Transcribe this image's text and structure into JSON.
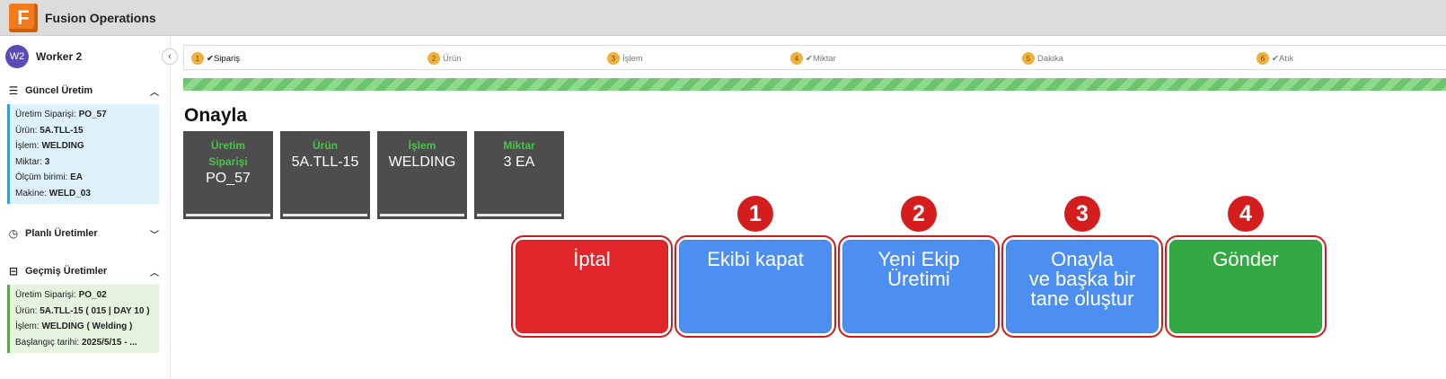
{
  "app": {
    "logo_letter": "F",
    "title": "Fusion Operations"
  },
  "user": {
    "initials": "W2",
    "name": "Worker 2"
  },
  "sidebar": {
    "current": {
      "title": "Güncel Üretim",
      "lines": [
        {
          "label": "Üretim Siparişi: ",
          "value": "PO_57"
        },
        {
          "label": "Ürün: ",
          "value": "5A.TLL-15"
        },
        {
          "label": "İşlem: ",
          "value": "WELDING"
        },
        {
          "label": "Miktar: ",
          "value": "3"
        },
        {
          "label": "Ölçüm birimi: ",
          "value": "EA"
        },
        {
          "label": "Makine: ",
          "value": "WELD_03"
        }
      ]
    },
    "planned": {
      "title": "Planlı Üretimler"
    },
    "past": {
      "title": "Geçmiş Üretimler",
      "lines": [
        {
          "label": "Üretim Siparişi: ",
          "value": "PO_02"
        },
        {
          "label": "Ürün: ",
          "value": "5A.TLL-15 ( 015 | DAY 10 )"
        },
        {
          "label": "İşlem: ",
          "value": "WELDING ( Welding )"
        },
        {
          "label": "Başlangıç tarihi: ",
          "value": "2025/5/15 - ..."
        }
      ]
    }
  },
  "steps": [
    {
      "num": "1",
      "check": "✔",
      "label": "Sipariş",
      "active": true
    },
    {
      "num": "2",
      "check": "",
      "label": "Ürün",
      "active": false
    },
    {
      "num": "3",
      "check": "",
      "label": "İşlem",
      "active": false
    },
    {
      "num": "4",
      "check": "✔",
      "label": "Miktar",
      "active": false
    },
    {
      "num": "5",
      "check": "",
      "label": "Dakika",
      "active": false
    },
    {
      "num": "6",
      "check": "✔",
      "label": "Atık",
      "active": false
    }
  ],
  "confirm": {
    "title": "Onayla",
    "cards": [
      {
        "label": "Üretim Siparişi",
        "value": "PO_57"
      },
      {
        "label": "Ürün",
        "value": "5A.TLL-15"
      },
      {
        "label": "İşlem",
        "value": "WELDING"
      },
      {
        "label": "Miktar",
        "value": "3 EA"
      }
    ]
  },
  "actions": [
    {
      "label": "İptal",
      "badge": "",
      "color": "#e0262a"
    },
    {
      "label": "Ekibi kapat",
      "badge": "1",
      "color": "#4d8ff0"
    },
    {
      "label": "Yeni Ekip\nÜretimi",
      "badge": "2",
      "color": "#4d8ff0"
    },
    {
      "label": "Onayla\nve başka bir\ntane oluştur",
      "badge": "3",
      "color": "#4d8ff0"
    },
    {
      "label": "Gönder",
      "badge": "4",
      "color": "#33a843"
    }
  ]
}
